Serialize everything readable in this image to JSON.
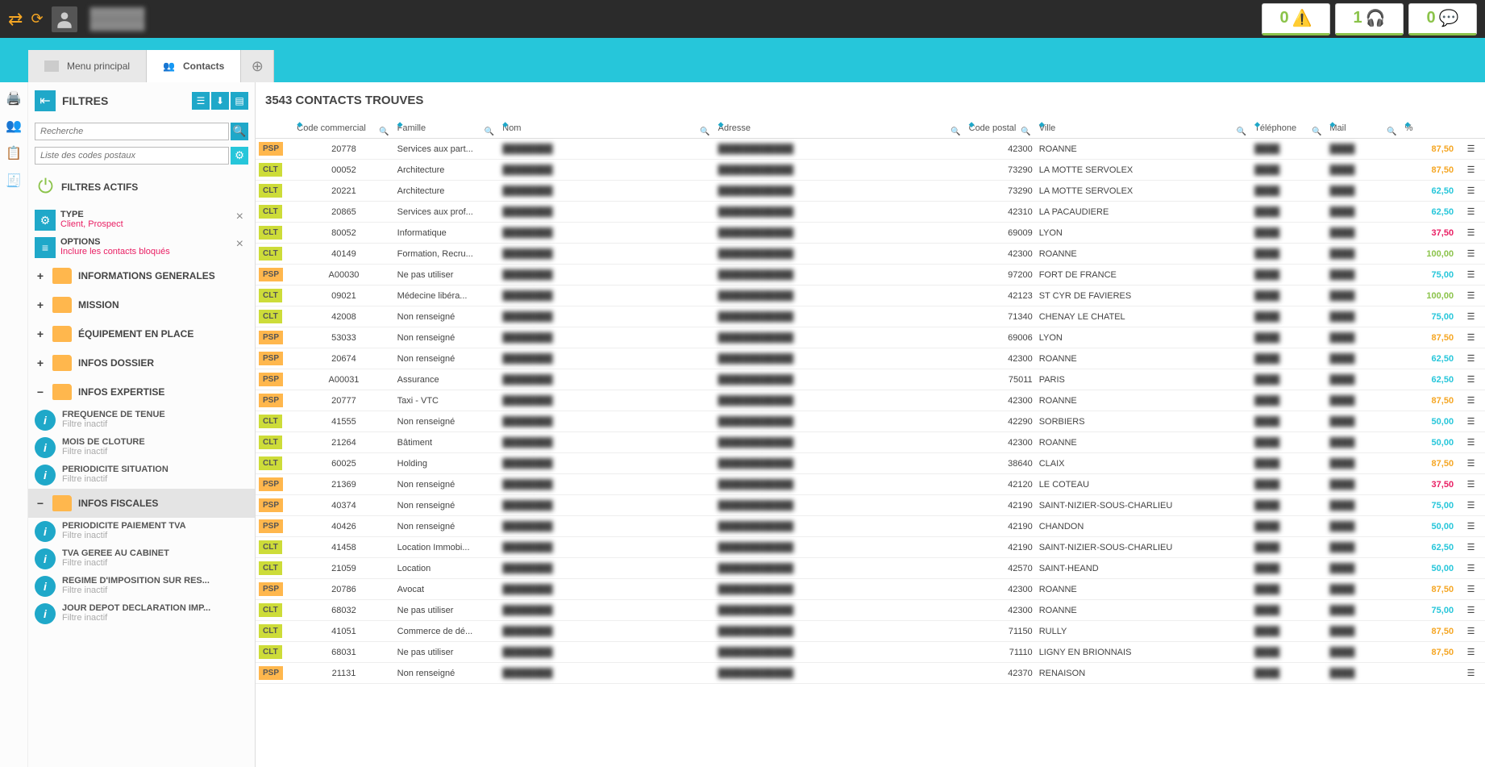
{
  "topbar": {
    "status": [
      {
        "num": "0",
        "color": "#8bc34a",
        "icon": "warning"
      },
      {
        "num": "1",
        "color": "#8bc34a",
        "icon": "headset"
      },
      {
        "num": "0",
        "color": "#8bc34a",
        "icon": "chat"
      }
    ]
  },
  "tabs": {
    "main_menu": "Menu principal",
    "contacts": "Contacts"
  },
  "sidebar": {
    "title": "FILTRES",
    "search_placeholder": "Recherche",
    "postal_placeholder": "Liste des codes postaux",
    "active_filters_label": "FILTRES ACTIFS",
    "active": [
      {
        "name": "TYPE",
        "value": "Client, Prospect",
        "icon": "gear"
      },
      {
        "name": "OPTIONS",
        "value": "Inclure les contacts bloqués",
        "icon": "list"
      }
    ],
    "folders": [
      {
        "toggle": "+",
        "label": "INFORMATIONS GENERALES"
      },
      {
        "toggle": "+",
        "label": "MISSION"
      },
      {
        "toggle": "+",
        "label": "ÉQUIPEMENT EN PLACE"
      },
      {
        "toggle": "+",
        "label": "INFOS DOSSIER"
      },
      {
        "toggle": "−",
        "label": "INFOS EXPERTISE"
      }
    ],
    "expertise_items": [
      {
        "name": "FREQUENCE DE TENUE",
        "status": "Filtre inactif"
      },
      {
        "name": "MOIS DE CLOTURE",
        "status": "Filtre inactif"
      },
      {
        "name": "PERIODICITE SITUATION",
        "status": "Filtre inactif"
      }
    ],
    "fiscales_folder": {
      "toggle": "−",
      "label": "INFOS FISCALES"
    },
    "fiscales_items": [
      {
        "name": "PERIODICITE PAIEMENT TVA",
        "status": "Filtre inactif"
      },
      {
        "name": "TVA GEREE AU CABINET",
        "status": "Filtre inactif"
      },
      {
        "name": "REGIME D'IMPOSITION SUR RES...",
        "status": "Filtre inactif"
      },
      {
        "name": "JOUR DEPOT DECLARATION IMP...",
        "status": "Filtre inactif"
      }
    ]
  },
  "main": {
    "title": "3543 CONTACTS TROUVES",
    "headers": [
      "",
      "Code commercial",
      "Famille",
      "Nom",
      "Adresse",
      "Code postal",
      "Ville",
      "Téléphone",
      "Mail",
      "%",
      ""
    ],
    "rows": [
      {
        "tag": "PSP",
        "code": "20778",
        "fam": "Services aux part...",
        "cp": "42300",
        "ville": "ROANNE",
        "pct": "87,50",
        "pctColor": "#f5a623"
      },
      {
        "tag": "CLT",
        "code": "00052",
        "fam": "Architecture",
        "cp": "73290",
        "ville": "LA MOTTE SERVOLEX",
        "pct": "87,50",
        "pctColor": "#f5a623"
      },
      {
        "tag": "CLT",
        "code": "20221",
        "fam": "Architecture",
        "cp": "73290",
        "ville": "LA MOTTE SERVOLEX",
        "pct": "62,50",
        "pctColor": "#26c6da"
      },
      {
        "tag": "CLT",
        "code": "20865",
        "fam": "Services aux prof...",
        "cp": "42310",
        "ville": "LA PACAUDIERE",
        "pct": "62,50",
        "pctColor": "#26c6da"
      },
      {
        "tag": "CLT",
        "code": "80052",
        "fam": "Informatique",
        "cp": "69009",
        "ville": "LYON",
        "pct": "37,50",
        "pctColor": "#e91e63"
      },
      {
        "tag": "CLT",
        "code": "40149",
        "fam": "Formation, Recru...",
        "cp": "42300",
        "ville": "ROANNE",
        "pct": "100,00",
        "pctColor": "#8bc34a"
      },
      {
        "tag": "PSP",
        "code": "A00030",
        "fam": "Ne pas utiliser",
        "cp": "97200",
        "ville": "FORT DE FRANCE",
        "pct": "75,00",
        "pctColor": "#26c6da"
      },
      {
        "tag": "CLT",
        "code": "09021",
        "fam": "Médecine libéra...",
        "cp": "42123",
        "ville": "ST CYR DE FAVIERES",
        "pct": "100,00",
        "pctColor": "#8bc34a"
      },
      {
        "tag": "CLT",
        "code": "42008",
        "fam": "Non renseigné",
        "cp": "71340",
        "ville": "CHENAY LE CHATEL",
        "pct": "75,00",
        "pctColor": "#26c6da"
      },
      {
        "tag": "PSP",
        "code": "53033",
        "fam": "Non renseigné",
        "cp": "69006",
        "ville": "LYON",
        "pct": "87,50",
        "pctColor": "#f5a623"
      },
      {
        "tag": "PSP",
        "code": "20674",
        "fam": "Non renseigné",
        "cp": "42300",
        "ville": "ROANNE",
        "pct": "62,50",
        "pctColor": "#26c6da"
      },
      {
        "tag": "PSP",
        "code": "A00031",
        "fam": "Assurance",
        "cp": "75011",
        "ville": "PARIS",
        "pct": "62,50",
        "pctColor": "#26c6da"
      },
      {
        "tag": "PSP",
        "code": "20777",
        "fam": "Taxi - VTC",
        "cp": "42300",
        "ville": "ROANNE",
        "pct": "87,50",
        "pctColor": "#f5a623"
      },
      {
        "tag": "CLT",
        "code": "41555",
        "fam": "Non renseigné",
        "cp": "42290",
        "ville": "SORBIERS",
        "pct": "50,00",
        "pctColor": "#26c6da"
      },
      {
        "tag": "CLT",
        "code": "21264",
        "fam": "Bâtiment",
        "cp": "42300",
        "ville": "ROANNE",
        "pct": "50,00",
        "pctColor": "#26c6da"
      },
      {
        "tag": "CLT",
        "code": "60025",
        "fam": "Holding",
        "cp": "38640",
        "ville": "CLAIX",
        "pct": "87,50",
        "pctColor": "#f5a623"
      },
      {
        "tag": "PSP",
        "code": "21369",
        "fam": "Non renseigné",
        "cp": "42120",
        "ville": "LE COTEAU",
        "pct": "37,50",
        "pctColor": "#e91e63"
      },
      {
        "tag": "PSP",
        "code": "40374",
        "fam": "Non renseigné",
        "cp": "42190",
        "ville": "SAINT-NIZIER-SOUS-CHARLIEU",
        "pct": "75,00",
        "pctColor": "#26c6da"
      },
      {
        "tag": "PSP",
        "code": "40426",
        "fam": "Non renseigné",
        "cp": "42190",
        "ville": "CHANDON",
        "pct": "50,00",
        "pctColor": "#26c6da"
      },
      {
        "tag": "CLT",
        "code": "41458",
        "fam": "Location Immobi...",
        "cp": "42190",
        "ville": "SAINT-NIZIER-SOUS-CHARLIEU",
        "pct": "62,50",
        "pctColor": "#26c6da"
      },
      {
        "tag": "CLT",
        "code": "21059",
        "fam": "Location",
        "cp": "42570",
        "ville": "SAINT-HEAND",
        "pct": "50,00",
        "pctColor": "#26c6da"
      },
      {
        "tag": "PSP",
        "code": "20786",
        "fam": "Avocat",
        "cp": "42300",
        "ville": "ROANNE",
        "pct": "87,50",
        "pctColor": "#f5a623"
      },
      {
        "tag": "CLT",
        "code": "68032",
        "fam": "Ne pas utiliser",
        "cp": "42300",
        "ville": "ROANNE",
        "pct": "75,00",
        "pctColor": "#26c6da"
      },
      {
        "tag": "CLT",
        "code": "41051",
        "fam": "Commerce de dé...",
        "cp": "71150",
        "ville": "RULLY",
        "pct": "87,50",
        "pctColor": "#f5a623"
      },
      {
        "tag": "CLT",
        "code": "68031",
        "fam": "Ne pas utiliser",
        "cp": "71110",
        "ville": "LIGNY EN BRIONNAIS",
        "pct": "87,50",
        "pctColor": "#f5a623"
      },
      {
        "tag": "PSP",
        "code": "21131",
        "fam": "Non renseigné",
        "cp": "42370",
        "ville": "RENAISON",
        "pct": "",
        "pctColor": ""
      }
    ]
  }
}
